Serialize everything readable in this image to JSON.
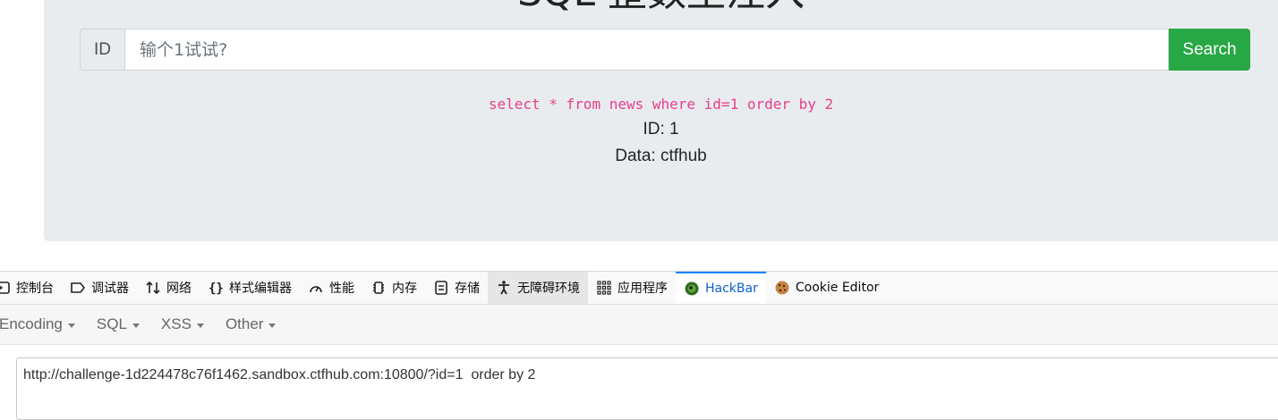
{
  "page": {
    "title": "SQL 整数型注入",
    "search": {
      "prefix": "ID",
      "placeholder": "输个1试试?",
      "value": "",
      "button_label": "Search"
    },
    "result": {
      "query": "select * from news where id=1 order by 2",
      "id_line": "ID: 1",
      "data_line": "Data: ctfhub"
    }
  },
  "devtools": {
    "tabs": [
      {
        "label": "控制台",
        "icon": "console-icon"
      },
      {
        "label": "调试器",
        "icon": "debugger-icon"
      },
      {
        "label": "网络",
        "icon": "network-icon"
      },
      {
        "label": "样式编辑器",
        "icon": "style-editor-icon"
      },
      {
        "label": "性能",
        "icon": "performance-icon"
      },
      {
        "label": "内存",
        "icon": "memory-icon"
      },
      {
        "label": "存储",
        "icon": "storage-icon"
      },
      {
        "label": "无障碍环境",
        "icon": "accessibility-icon"
      },
      {
        "label": "应用程序",
        "icon": "application-icon"
      },
      {
        "label": "HackBar",
        "icon": "hackbar-icon"
      },
      {
        "label": "Cookie Editor",
        "icon": "cookie-icon"
      }
    ],
    "active_tab": "HackBar",
    "accent_color": "#0a84ff"
  },
  "hackbar": {
    "menu": [
      "Encoding",
      "SQL",
      "XSS",
      "Other"
    ],
    "url": "http://challenge-1d224478c76f1462.sandbox.ctfhub.com:10800/?id=1  order by 2"
  },
  "colors": {
    "search_button": "#28a745",
    "query_text": "#e83e8c",
    "jumbotron_bg": "#e9ecef"
  }
}
